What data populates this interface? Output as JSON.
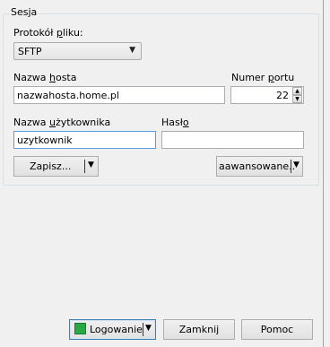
{
  "session": {
    "legend": "Sesja",
    "protocol_label_pre": "Protokół ",
    "protocol_label_ul": "p",
    "protocol_label_post": "liku:",
    "protocol_value": "SFTP",
    "host_label_pre": "Nazwa ",
    "host_label_ul": "h",
    "host_label_post": "osta",
    "host_value": "nazwahosta.home.pl",
    "port_label_pre": "Numer ",
    "port_label_ul": "p",
    "port_label_post": "ortu",
    "port_value": "22",
    "user_label_pre": "Nazwa ",
    "user_label_ul": "u",
    "user_label_post": "żytkownika",
    "user_value": "uzytkownik",
    "password_label_pre": "Hasł",
    "password_label_ul": "o",
    "password_label_post": "",
    "password_value": "",
    "save_label": "Zapisz...",
    "advanced_label": "aawansowane.."
  },
  "footer": {
    "login_label": "Logowanie",
    "close_label": "Zamknij",
    "help_label": "Pomoc"
  }
}
